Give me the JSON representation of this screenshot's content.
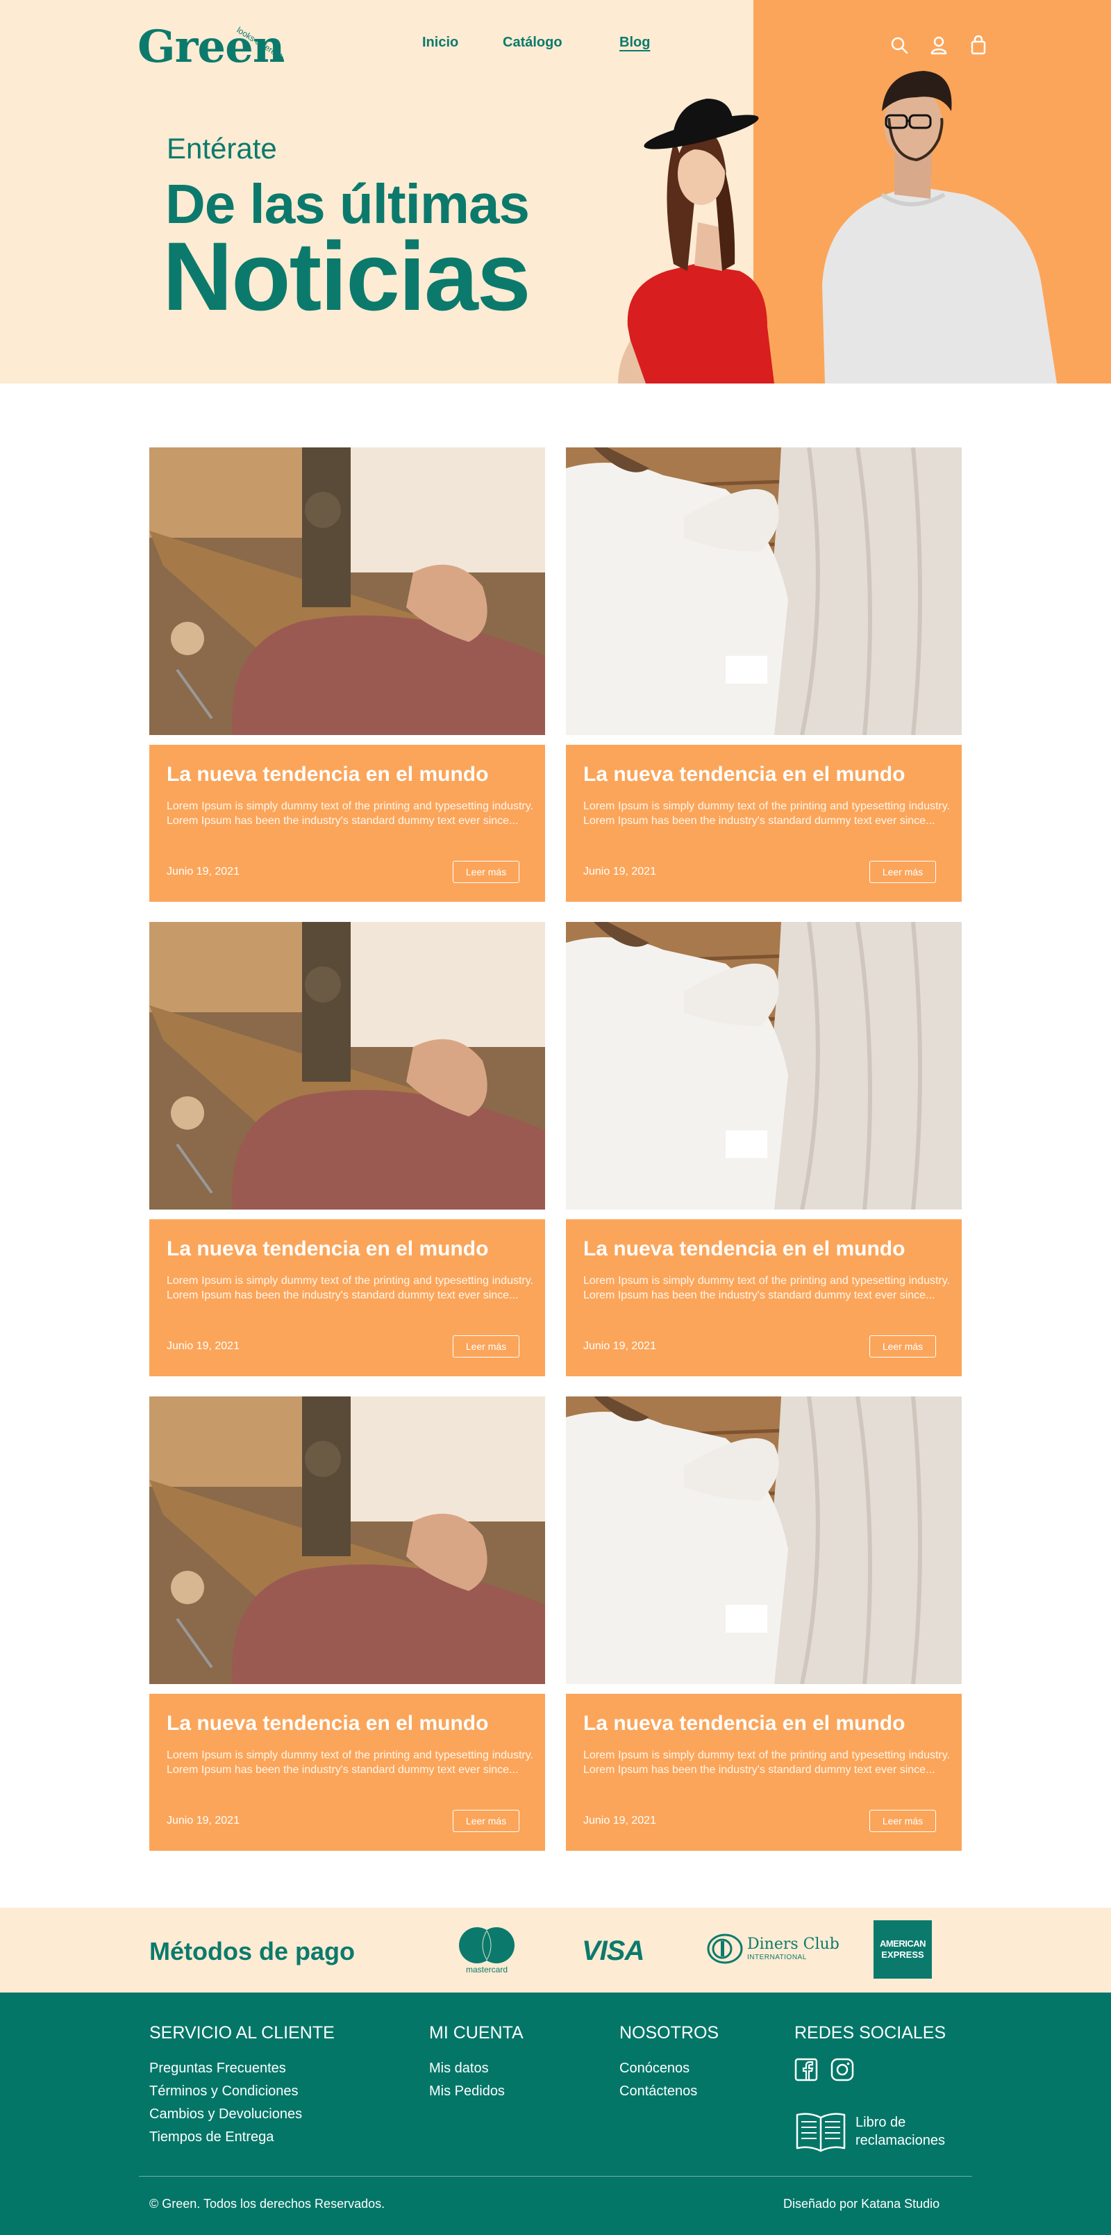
{
  "brand": {
    "logo_text": "Green",
    "logo_tagline": "looks different",
    "colors": {
      "teal": "#0b7a6c",
      "orange": "#fba55a",
      "cream": "#fdebd3",
      "footer": "#037668"
    }
  },
  "nav": {
    "items": [
      {
        "label": "Inicio"
      },
      {
        "label": "Catálogo"
      },
      {
        "label": "Blog",
        "active": true
      }
    ]
  },
  "header_icons": [
    "search-icon",
    "user-icon",
    "shopping-bag-icon"
  ],
  "hero": {
    "kicker": "Entérate",
    "line1": "De las últimas",
    "line2": "Noticias"
  },
  "posts": [
    {
      "image": "sewing-machine",
      "title": "La nueva tendencia en el mundo",
      "excerpt": "Lorem Ipsum is simply dummy text of the printing and typesetting industry. Lorem Ipsum has been the industry's standard dummy text ever since...",
      "date": "Junio 19, 2021",
      "button": "Leer más"
    },
    {
      "image": "tailor-fabric",
      "title": "La nueva tendencia en el mundo",
      "excerpt": "Lorem Ipsum is simply dummy text of the printing and typesetting industry. Lorem Ipsum has been the industry's standard dummy text ever since...",
      "date": "Junio 19, 2021",
      "button": "Leer más"
    },
    {
      "image": "sewing-machine",
      "title": "La nueva tendencia en el mundo",
      "excerpt": "Lorem Ipsum is simply dummy text of the printing and typesetting industry. Lorem Ipsum has been the industry's standard dummy text ever since...",
      "date": "Junio 19, 2021",
      "button": "Leer más"
    },
    {
      "image": "tailor-fabric",
      "title": "La nueva tendencia en el mundo",
      "excerpt": "Lorem Ipsum is simply dummy text of the printing and typesetting industry. Lorem Ipsum has been the industry's standard dummy text ever since...",
      "date": "Junio 19, 2021",
      "button": "Leer más"
    },
    {
      "image": "sewing-machine",
      "title": "La nueva tendencia en el mundo",
      "excerpt": "Lorem Ipsum is simply dummy text of the printing and typesetting industry. Lorem Ipsum has been the industry's standard dummy text ever since...",
      "date": "Junio 19, 2021",
      "button": "Leer más"
    },
    {
      "image": "tailor-fabric",
      "title": "La nueva tendencia en el mundo",
      "excerpt": "Lorem Ipsum is simply dummy text of the printing and typesetting industry. Lorem Ipsum has been the industry's standard dummy text ever since...",
      "date": "Junio 19, 2021",
      "button": "Leer más"
    }
  ],
  "payment": {
    "title": "Métodos de pago",
    "methods": [
      {
        "name": "mastercard",
        "label": "mastercard"
      },
      {
        "name": "visa",
        "label": "VISA"
      },
      {
        "name": "diners",
        "label": "Diners Club",
        "sublabel": "INTERNATIONAL"
      },
      {
        "name": "amex",
        "label": "AMERICAN",
        "sublabel": "EXPRESS"
      }
    ]
  },
  "footer": {
    "columns": [
      {
        "title": "SERVICIO AL CLIENTE",
        "links": [
          "Preguntas Frecuentes",
          "Términos y Condiciones",
          "Cambios y Devoluciones",
          "Tiempos de Entrega"
        ]
      },
      {
        "title": "MI CUENTA",
        "links": [
          "Mis datos",
          "Mis Pedidos"
        ]
      },
      {
        "title": "NOSOTROS",
        "links": [
          "Conócenos",
          "Contáctenos"
        ]
      },
      {
        "title": "REDES SOCIALES",
        "links": []
      }
    ],
    "social": [
      "facebook-icon",
      "instagram-icon"
    ],
    "libro": {
      "line1": "Libro de",
      "line2": "reclamaciones"
    },
    "copyright": "© Green. Todos los derechos Reservados.",
    "credit": "Diseñado por Katana Studio"
  }
}
